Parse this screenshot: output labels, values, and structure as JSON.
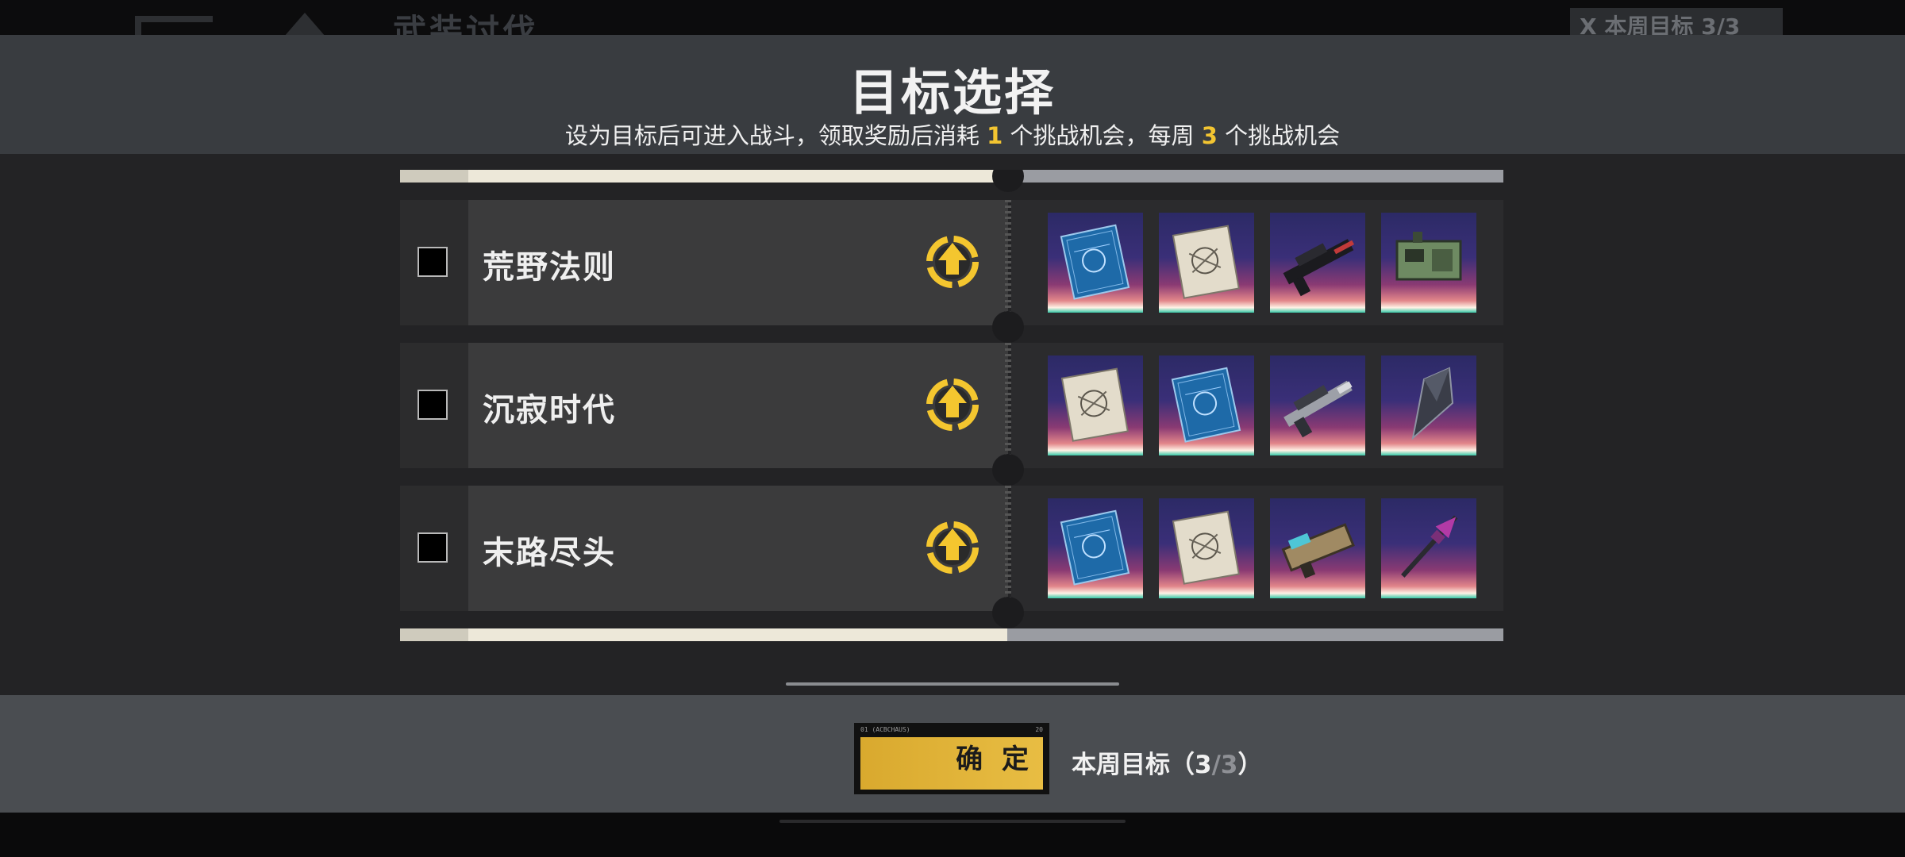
{
  "background": {
    "page_title": "武装讨伐",
    "weekly_goal_label": "X 本周目标",
    "weekly_goal_value": "3/3"
  },
  "modal": {
    "title": "目标选择",
    "subtitle_part1": "设为目标后可进入战斗，领取奖励后消耗",
    "subtitle_num1": "1",
    "subtitle_part2": "个挑战机会，每周",
    "subtitle_num2": "3",
    "subtitle_part3": "个挑战机会"
  },
  "targets": [
    {
      "name": "荒野法则",
      "checked": false,
      "upgrade_icon": "upgrade-arrow-icon",
      "rewards": [
        "blueprint-blue-icon",
        "blueprint-beige-icon",
        "dark-rifle-icon",
        "green-device-icon"
      ]
    },
    {
      "name": "沉寂时代",
      "checked": false,
      "upgrade_icon": "upgrade-arrow-icon",
      "rewards": [
        "blueprint-beige-icon",
        "blueprint-blue-icon",
        "grey-rifle-icon",
        "dark-blade-icon"
      ]
    },
    {
      "name": "末路尽头",
      "checked": false,
      "upgrade_icon": "upgrade-arrow-icon",
      "rewards": [
        "blueprint-blue-icon",
        "blueprint-beige-icon",
        "gold-launcher-icon",
        "purple-spear-icon"
      ]
    }
  ],
  "footer": {
    "confirm_label": "确 定",
    "confirm_tiny_left": "01 (ACBCHAUS)",
    "confirm_tiny_right": "20",
    "goal_label": "本周目标（",
    "goal_current": "3",
    "goal_sep": "/",
    "goal_max": "3",
    "goal_close": "）"
  },
  "colors": {
    "accent_yellow": "#f3c531",
    "header_bg": "#393c40",
    "content_bg": "#232325",
    "footer_bg": "#4a4d51"
  }
}
